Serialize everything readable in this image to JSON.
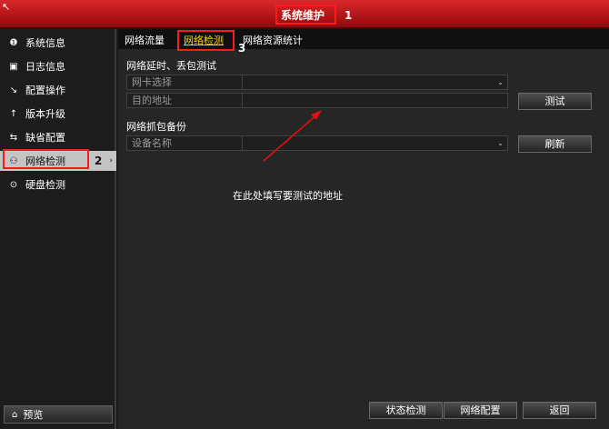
{
  "window": {
    "title": "系统维护",
    "cursor": "↖"
  },
  "annotations": {
    "n1": "1",
    "n2": "2",
    "n3": "3",
    "hint": "在此处填写要测试的地址"
  },
  "sidebar": {
    "items": [
      {
        "label": "系统信息",
        "icon": "info-icon",
        "glyph": "❶"
      },
      {
        "label": "日志信息",
        "icon": "log-icon",
        "glyph": "▣"
      },
      {
        "label": "配置操作",
        "icon": "config-icon",
        "glyph": "↘"
      },
      {
        "label": "版本升级",
        "icon": "upgrade-icon",
        "glyph": "↑"
      },
      {
        "label": "缺省配置",
        "icon": "default-config-icon",
        "glyph": "⇆"
      },
      {
        "label": "网络检测",
        "icon": "network-icon",
        "glyph": "⚇",
        "chevron": "›"
      },
      {
        "label": "硬盘检测",
        "icon": "disk-icon",
        "glyph": "⊙"
      }
    ],
    "preview": {
      "label": "预览",
      "icon": "home-icon",
      "glyph": "⌂"
    }
  },
  "tabs": [
    {
      "label": "网络流量"
    },
    {
      "label": "网络检测"
    },
    {
      "label": "网络资源统计"
    }
  ],
  "delay_test": {
    "title": "网络延时、丢包测试",
    "nic_label": "网卡选择",
    "nic_value": "",
    "dest_label": "目的地址",
    "dest_value": "",
    "test_button": "测试"
  },
  "capture": {
    "title": "网络抓包备份",
    "device_label": "设备名称",
    "device_value": "",
    "refresh_button": "刷新"
  },
  "bottom": {
    "status_button": "状态检测",
    "netconfig_button": "网络配置",
    "back_button": "返回"
  },
  "colors": {
    "title_red": "#c41c20",
    "active_tab": "#f5d400",
    "annotation": "#ff1a1a",
    "arrow": "#e01010"
  }
}
